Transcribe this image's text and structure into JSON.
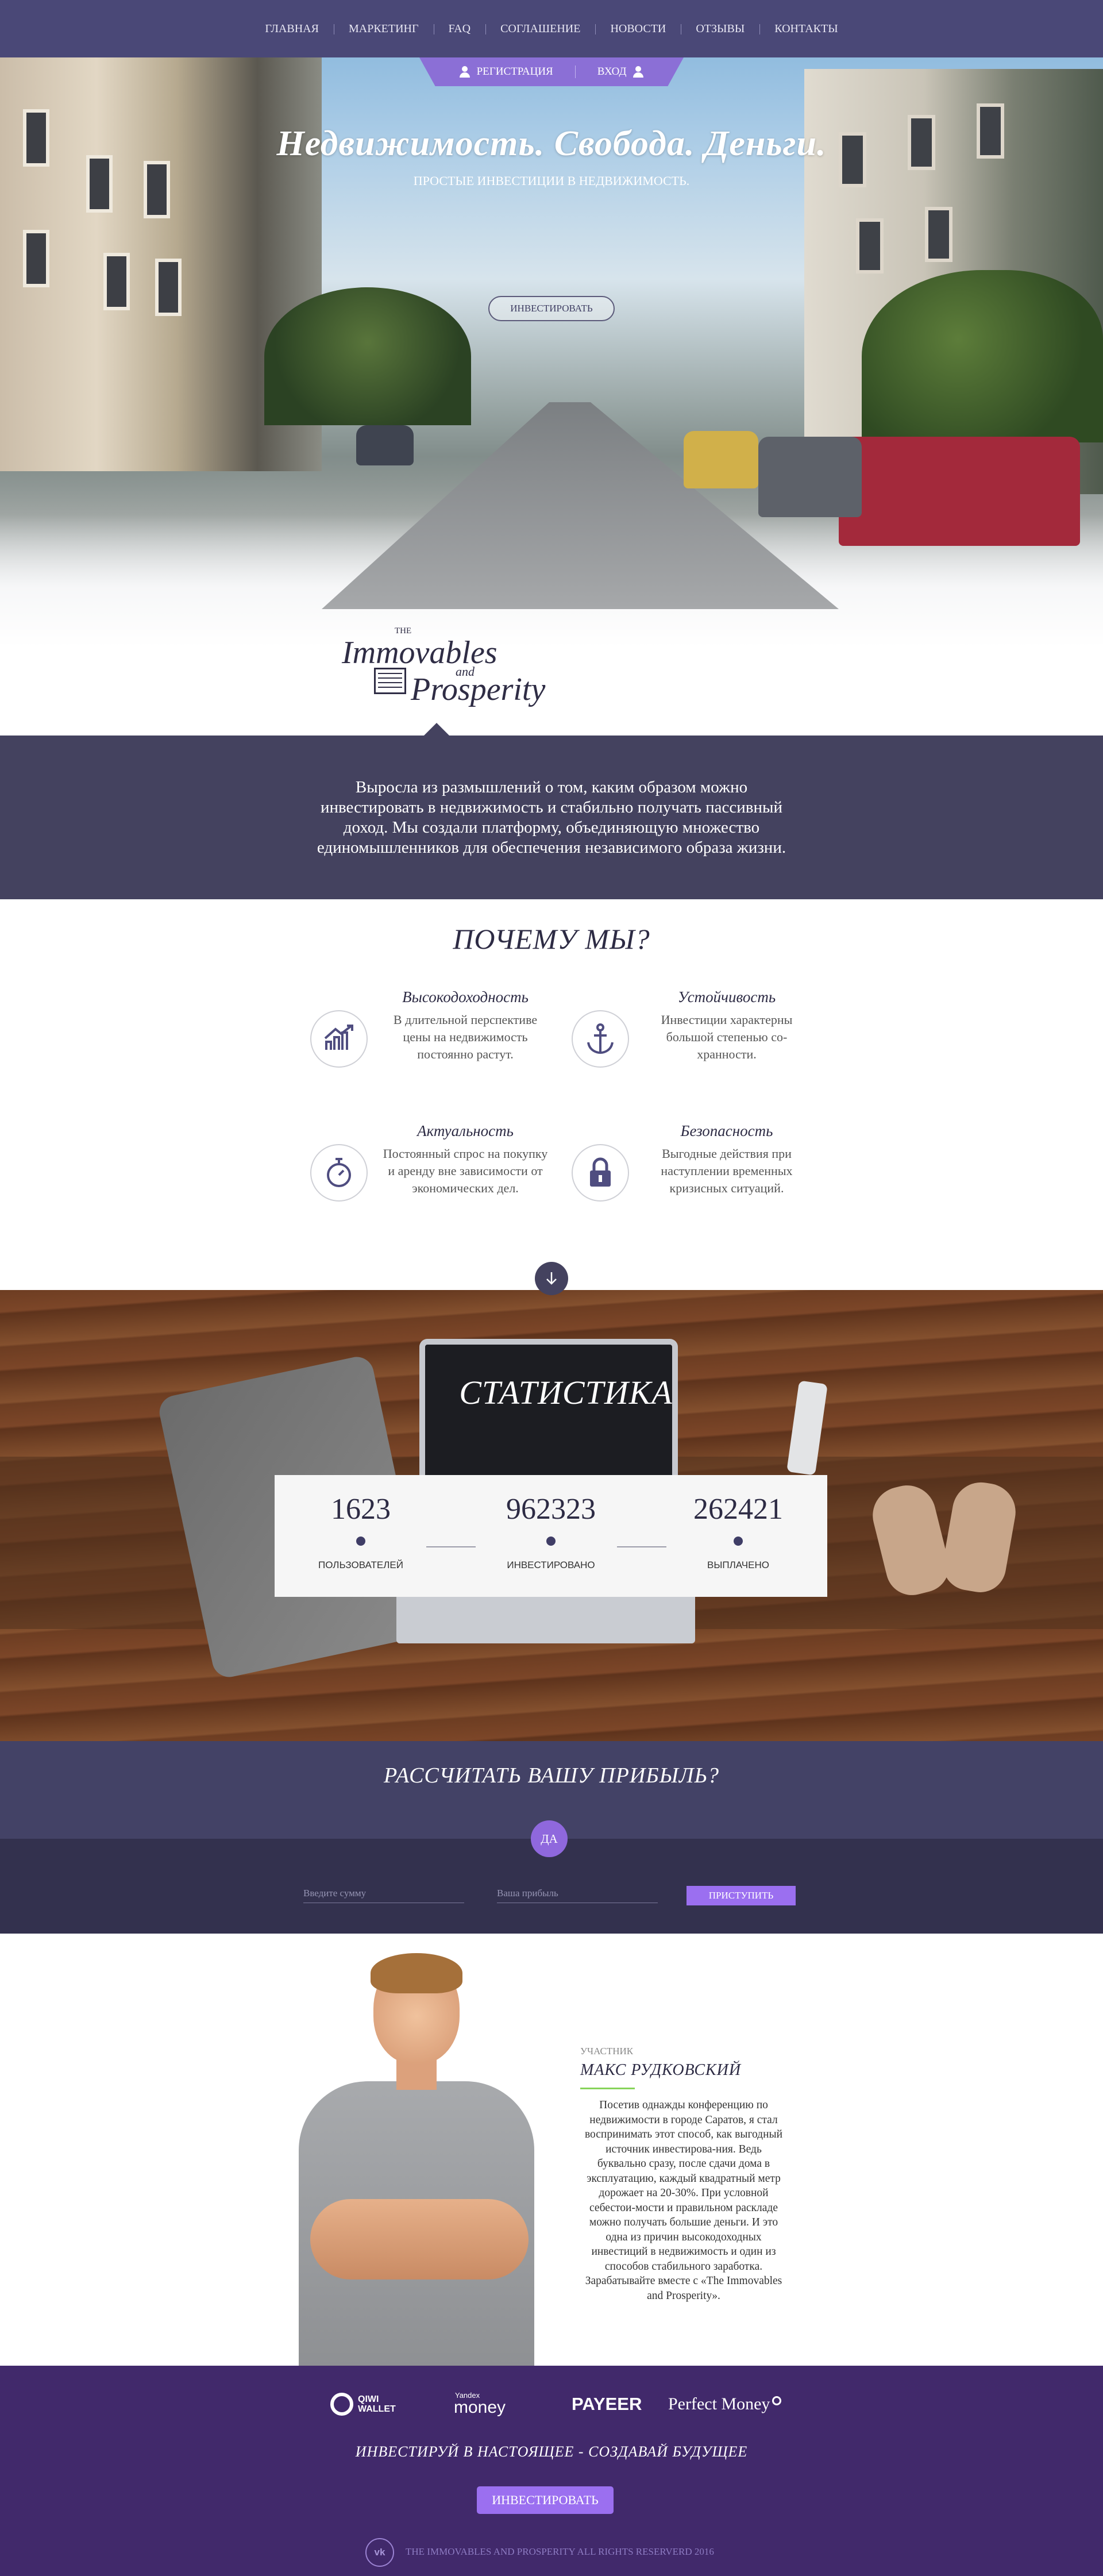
{
  "nav": {
    "items": [
      "Главная",
      "Маркетинг",
      "FAQ",
      "Соглашение",
      "Новости",
      "Отзывы",
      "Контакты"
    ]
  },
  "auth": {
    "register": "Регистрация",
    "login": "Вход"
  },
  "hero": {
    "title": "Недвижимость. Свобода. Деньги.",
    "subtitle": "Простые инвестиции в недвижимость.",
    "button": "Инвестировать"
  },
  "logo": {
    "the": "THE",
    "line1": "Immovables",
    "and": "and",
    "line2": "Prosperity"
  },
  "about": {
    "text": "Выросла из размышлений о том, каким образом можно инвестировать в недвижимость и стабильно получать пассивный доход. Мы создали платформу, объединяющую множество единомышленников для обеспечения независимого образа жизни."
  },
  "why": {
    "title": "Почему мы?",
    "features": [
      {
        "title": "Высокодоходность",
        "text": "В длительной перспективе цены на недвижимость постоянно растут.",
        "icon": "growth-chart-icon"
      },
      {
        "title": "Устойчивость",
        "text": "Инвестиции характерны большой степенью со-хранности.",
        "icon": "anchor-icon"
      },
      {
        "title": "Актуальность",
        "text": "Постоянный спрос на покупку и аренду вне зависимости от экономических дел.",
        "icon": "stopwatch-icon"
      },
      {
        "title": "Безопасность",
        "text": "Выгодные действия при наступлении временных кризисных ситуаций.",
        "icon": "lock-icon"
      }
    ]
  },
  "stats": {
    "title": "Статистика",
    "items": [
      {
        "value": "1623",
        "label": "Пользователей"
      },
      {
        "value": "962323",
        "label": "Инвестировано"
      },
      {
        "value": "262421",
        "label": "Выплачено"
      }
    ]
  },
  "calc": {
    "title": "Рассчитать вашу прибыль?",
    "yes": "Да",
    "amount_placeholder": "Введите сумму",
    "profit_placeholder": "Ваша прибыль",
    "button": "Приступить"
  },
  "testimonial": {
    "role": "Участник",
    "name": "Макс Рудковский",
    "text": "Посетив однажды конференцию по недвижимости в городе Саратов, я стал воспринимать этот способ, как выгодный источник инвестирова-ния. Ведь буквально сразу, после сдачи дома в эксплуатацию, каждый квадратный метр дорожает на 20-30%. При условной себестои-мости и правильном раскладе можно получать большие деньги. И это одна из причин высокодоходных инвестиций в недвижимость и один из способов стабильного заработка. Зарабатывайте вместе с «The Immovables and Prosperity»."
  },
  "footer": {
    "payments": {
      "qiwi": [
        "QIWI",
        "WALLET"
      ],
      "yandex_small": "Yandex",
      "yandex_big": "money",
      "payeer": "PAYEER",
      "perfect_money": "Perfect Money"
    },
    "slogan": "Инвестируй в настоящее - создавай будущее",
    "button": "Инвестировать",
    "vk": "vk",
    "copyright": "The Immovables and Prosperity all rights reserverd 2016"
  },
  "colors": {
    "nav": "#4a4877",
    "accent": "#9b6ff0",
    "dark_band": "#44425f",
    "footer": "#41296b"
  }
}
